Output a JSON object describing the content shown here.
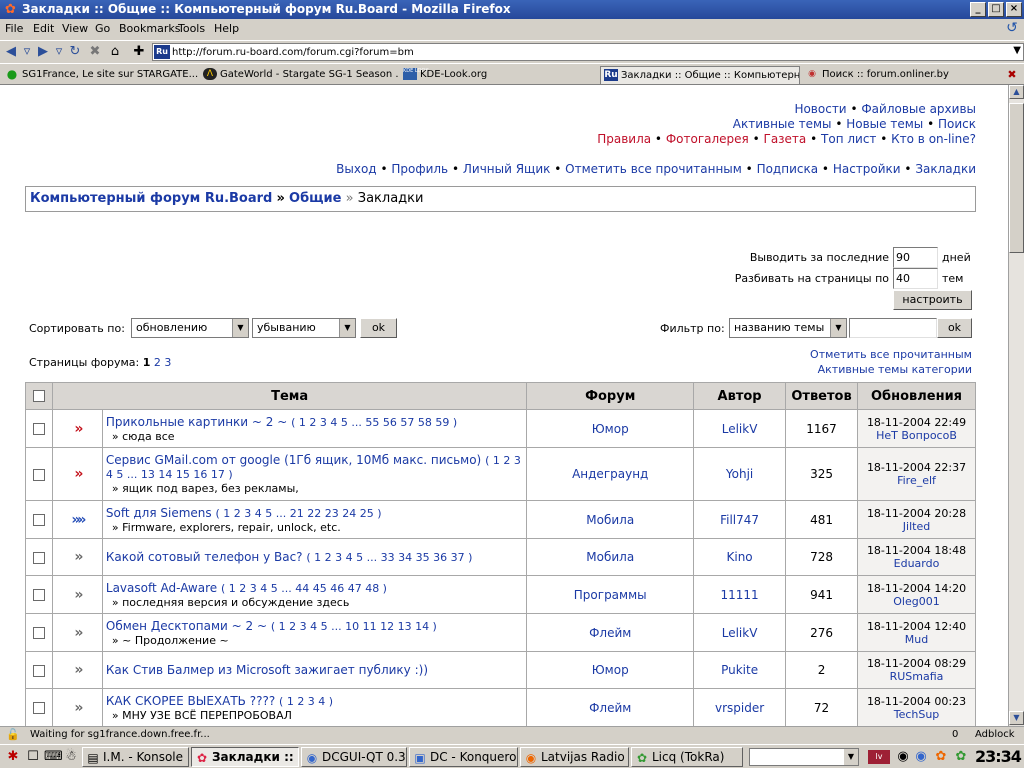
{
  "window": {
    "title": "Закладки :: Общие :: Компьютерный форум Ru.Board - Mozilla Firefox"
  },
  "menu": [
    "File",
    "Edit",
    "View",
    "Go",
    "Bookmarks",
    "Tools",
    "Help"
  ],
  "nav": {
    "url": "http://forum.ru-board.com/forum.cgi?forum=bm",
    "favicon_text": "Ru"
  },
  "tabs": [
    {
      "label": "SG1France, Le site sur STARGATE...",
      "icon": "green-dot-icon"
    },
    {
      "label": "GateWorld - Stargate SG-1 Season ...",
      "icon": "stargate-icon"
    },
    {
      "label": "KDE-Look.org",
      "icon": "kde-look-icon",
      "icon_text": "KDE LOOK"
    },
    {
      "label": "Закладки :: Общие :: Компьютерн...",
      "icon": "ruboard-icon",
      "icon_text": "Ru",
      "active": true
    },
    {
      "label": "Поиск :: forum.onliner.by",
      "icon": "onliner-icon"
    }
  ],
  "toplinks": {
    "row1": [
      "Новости",
      "Файловые архивы"
    ],
    "row2": [
      "Активные темы",
      "Новые темы",
      "Поиск"
    ],
    "row3": [
      {
        "text": "Правила",
        "red": true
      },
      {
        "text": "Фотогалерея",
        "red": true
      },
      {
        "text": "Газета",
        "red": true
      },
      {
        "text": "Топ лист",
        "red": false
      },
      {
        "text": "Кто в on-line?",
        "red": false
      }
    ],
    "row4": [
      "Выход",
      "Профиль",
      "Личный Ящик",
      "Отметить все прочитанным",
      "Подписка",
      "Настройки",
      "Закладки"
    ]
  },
  "breadcrumb": {
    "forum": "Компьютерный форум Ru.Board",
    "sep": "»",
    "section": "Общие",
    "sep2": "»",
    "current": "Закладки"
  },
  "settings": {
    "days_label": "Выводить за последние",
    "days_value": "90",
    "days_unit": "дней",
    "pages_label": "Разбивать на страницы по",
    "pages_value": "40",
    "pages_unit": "тем",
    "apply_button": "настроить"
  },
  "sort": {
    "label": "Сортировать по:",
    "field": "обновлению",
    "order": "убыванию",
    "ok": "ok",
    "filter_label": "Фильтр по:",
    "filter_field": "названию темы",
    "filter_value": "",
    "filter_ok": "ok"
  },
  "pagination": {
    "label": "Страницы форума:",
    "current": "1",
    "pages": [
      "2",
      "3"
    ]
  },
  "side_links": [
    "Отметить все прочитанным",
    "Активные темы категории"
  ],
  "table": {
    "headers": [
      "Тема",
      "Форум",
      "Автор",
      "Ответов",
      "Обновления"
    ],
    "rows": [
      {
        "icon": "red",
        "title": "Прикольные картинки ~ 2 ~",
        "pages": "( 1 2 3 4 5 ... 55 56 57 58 59 )",
        "sub": "» сюда все",
        "forum": "Юмор",
        "author": "LelikV",
        "replies": "1167",
        "date": "18-11-2004 22:49",
        "user": "НеТ ВопросоВ"
      },
      {
        "icon": "red",
        "title": "Сервис GMail.com от google (1Гб ящик, 10Мб макс. письмо)",
        "pages": "( 1 2 3 4 5 ... 13 14 15 16 17 )",
        "sub": "» ящик под варез, без рекламы,",
        "forum": "Андеграунд",
        "author": "Yohji",
        "replies": "325",
        "date": "18-11-2004 22:37",
        "user": "Fire_elf"
      },
      {
        "icon": "blue",
        "title": "Soft для Siemens",
        "pages": "( 1 2 3 4 5 ... 21 22 23 24 25 )",
        "sub": "» Firmware, explorers, repair, unlock, etc.",
        "forum": "Мобила",
        "author": "Fill747",
        "replies": "481",
        "date": "18-11-2004 20:28",
        "user": "Jilted"
      },
      {
        "icon": "grey",
        "title": "Какой сотовый телефон у Вас?",
        "pages": "( 1 2 3 4 5 ... 33 34 35 36 37 )",
        "sub": "",
        "forum": "Мобила",
        "author": "Kino",
        "replies": "728",
        "date": "18-11-2004 18:48",
        "user": "Eduardo"
      },
      {
        "icon": "grey",
        "title": "Lavasoft Ad-Aware",
        "pages": "( 1 2 3 4 5 ... 44 45 46 47 48 )",
        "sub": "» последняя версия и обсуждение здесь",
        "forum": "Программы",
        "author": "11111",
        "replies": "941",
        "date": "18-11-2004 14:20",
        "user": "Oleg001"
      },
      {
        "icon": "grey",
        "title": "Обмен Десктопами ~ 2 ~",
        "pages": "( 1 2 3 4 5 ... 10 11 12 13 14 )",
        "sub": "» ~ Продолжение ~",
        "forum": "Флейм",
        "author": "LelikV",
        "replies": "276",
        "date": "18-11-2004 12:40",
        "user": "Mud"
      },
      {
        "icon": "grey",
        "title": "Как Стив Балмер из Microsoft зажигает публику :))",
        "pages": "",
        "sub": "",
        "forum": "Юмор",
        "author": "Pukite",
        "replies": "2",
        "date": "18-11-2004 08:29",
        "user": "RUSmafia"
      },
      {
        "icon": "grey",
        "title": "КАК СКОРЕЕ ВЫЕХАТЬ ????",
        "pages": "( 1 2 3 4 )",
        "sub": "» МНУ УЗЕ ВСЁ ПЕРЕПРОБОВАЛ",
        "forum": "Флейм",
        "author": "vrspider",
        "replies": "72",
        "date": "18-11-2004 00:23",
        "user": "TechSup"
      }
    ]
  },
  "status": {
    "text": "Waiting for sg1france.down.free.fr...",
    "count": "0",
    "adblock": "Adblock"
  },
  "taskbar": {
    "tasks": [
      {
        "label": "I.M. - Konsole",
        "active": false
      },
      {
        "label": "Закладки :: О",
        "active": true
      },
      {
        "label": "DCGUI-QT 0.3",
        "active": false
      },
      {
        "label": "DC - Konqueror",
        "active": false
      },
      {
        "label": "Latvijas Radio",
        "active": false
      },
      {
        "label": "Licq (TokRa)",
        "active": false
      }
    ],
    "flag": "lv",
    "clock": "23:34"
  }
}
